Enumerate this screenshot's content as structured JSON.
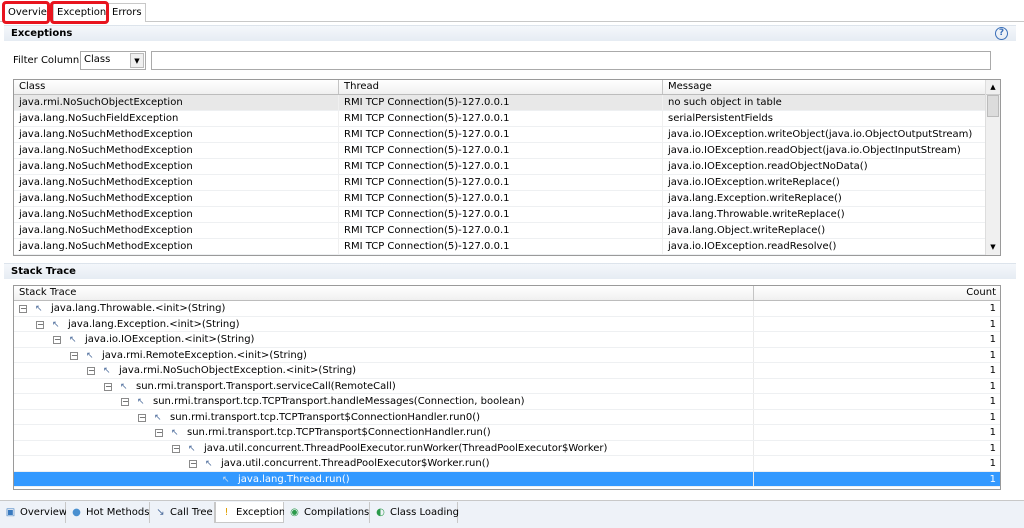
{
  "top_tabs": [
    "Overview",
    "Exceptions",
    "Errors"
  ],
  "exceptions": {
    "title": "Exceptions",
    "help_icon": "help-icon",
    "filter_label": "Filter Column",
    "filter_select": "Class",
    "filter_value": "",
    "columns": [
      "Class",
      "Thread",
      "Message"
    ],
    "rows": [
      [
        "java.rmi.NoSuchObjectException",
        "RMI TCP Connection(5)-127.0.0.1",
        "no such object in table"
      ],
      [
        "java.lang.NoSuchFieldException",
        "RMI TCP Connection(5)-127.0.0.1",
        "serialPersistentFields"
      ],
      [
        "java.lang.NoSuchMethodException",
        "RMI TCP Connection(5)-127.0.0.1",
        "java.io.IOException.writeObject(java.io.ObjectOutputStream)"
      ],
      [
        "java.lang.NoSuchMethodException",
        "RMI TCP Connection(5)-127.0.0.1",
        "java.io.IOException.readObject(java.io.ObjectInputStream)"
      ],
      [
        "java.lang.NoSuchMethodException",
        "RMI TCP Connection(5)-127.0.0.1",
        "java.io.IOException.readObjectNoData()"
      ],
      [
        "java.lang.NoSuchMethodException",
        "RMI TCP Connection(5)-127.0.0.1",
        "java.io.IOException.writeReplace()"
      ],
      [
        "java.lang.NoSuchMethodException",
        "RMI TCP Connection(5)-127.0.0.1",
        "java.lang.Exception.writeReplace()"
      ],
      [
        "java.lang.NoSuchMethodException",
        "RMI TCP Connection(5)-127.0.0.1",
        "java.lang.Throwable.writeReplace()"
      ],
      [
        "java.lang.NoSuchMethodException",
        "RMI TCP Connection(5)-127.0.0.1",
        "java.lang.Object.writeReplace()"
      ],
      [
        "java.lang.NoSuchMethodException",
        "RMI TCP Connection(5)-127.0.0.1",
        "java.io.IOException.readResolve()"
      ]
    ]
  },
  "stack": {
    "title": "Stack Trace",
    "columns": [
      "Stack Trace",
      "Count"
    ],
    "rows": [
      {
        "label": "java.lang.Throwable.<init>(String)",
        "count": "1"
      },
      {
        "label": "java.lang.Exception.<init>(String)",
        "count": "1"
      },
      {
        "label": "java.io.IOException.<init>(String)",
        "count": "1"
      },
      {
        "label": "java.rmi.RemoteException.<init>(String)",
        "count": "1"
      },
      {
        "label": "java.rmi.NoSuchObjectException.<init>(String)",
        "count": "1"
      },
      {
        "label": "sun.rmi.transport.Transport.serviceCall(RemoteCall)",
        "count": "1"
      },
      {
        "label": "sun.rmi.transport.tcp.TCPTransport.handleMessages(Connection, boolean)",
        "count": "1"
      },
      {
        "label": "sun.rmi.transport.tcp.TCPTransport$ConnectionHandler.run0()",
        "count": "1"
      },
      {
        "label": "sun.rmi.transport.tcp.TCPTransport$ConnectionHandler.run()",
        "count": "1"
      },
      {
        "label": "java.util.concurrent.ThreadPoolExecutor.runWorker(ThreadPoolExecutor$Worker)",
        "count": "1"
      },
      {
        "label": "java.util.concurrent.ThreadPoolExecutor$Worker.run()",
        "count": "1"
      },
      {
        "label": "java.lang.Thread.run()",
        "count": "1",
        "selected": true
      }
    ]
  },
  "bottom_tabs": [
    {
      "label": "Overview",
      "icon": "overview-icon",
      "glyph": "▣",
      "color": "#3a7abf"
    },
    {
      "label": "Hot Methods",
      "icon": "hot-methods-icon",
      "glyph": "●",
      "color": "#4a90d0"
    },
    {
      "label": "Call Tree",
      "icon": "call-tree-icon",
      "glyph": "↘",
      "color": "#4a6a9a"
    },
    {
      "label": "Exceptions",
      "icon": "exceptions-icon",
      "glyph": "!",
      "color": "#e0a000",
      "active": true
    },
    {
      "label": "Compilations",
      "icon": "compilations-icon",
      "glyph": "◉",
      "color": "#2a9a4a"
    },
    {
      "label": "Class Loading",
      "icon": "class-loading-icon",
      "glyph": "◐",
      "color": "#2a9a4a"
    }
  ],
  "colors": {
    "selection": "#3399ff",
    "annotation": "#e8141e"
  }
}
